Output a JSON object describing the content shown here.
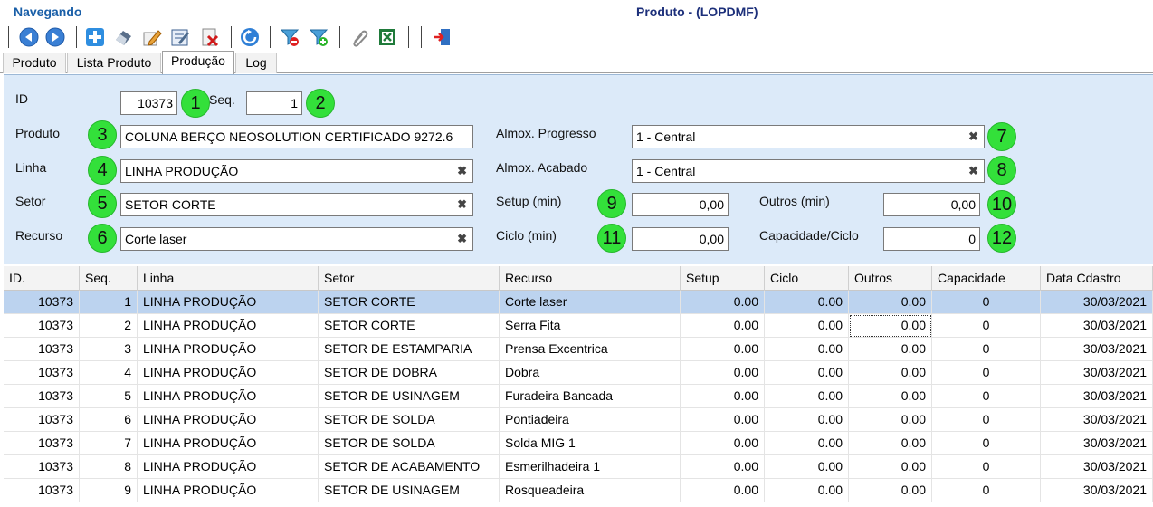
{
  "header": {
    "status": "Navegando",
    "title": "Produto - (LOPDMF)"
  },
  "toolbar": {
    "buttons": [
      "previous",
      "next",
      "new",
      "eraser",
      "edit",
      "edit-form",
      "delete",
      "refresh",
      "filter-remove",
      "filter-add",
      "attach",
      "excel",
      "exit"
    ]
  },
  "tabs": [
    "Produto",
    "Lista Produto",
    "Produção",
    "Log"
  ],
  "active_tab": "Produção",
  "form": {
    "id_label": "ID",
    "id_value": "10373",
    "seq_label": "Seq.",
    "seq_value": "1",
    "produto_label": "Produto",
    "produto_value": "COLUNA BERÇO NEOSOLUTION CERTIFICADO  9272.6",
    "linha_label": "Linha",
    "linha_value": "LINHA PRODUÇÃO",
    "setor_label": "Setor",
    "setor_value": "SETOR CORTE",
    "recurso_label": "Recurso",
    "recurso_value": "Corte laser",
    "almox_progresso_label": "Almox. Progresso",
    "almox_progresso_value": "1 - Central",
    "almox_acabado_label": "Almox. Acabado",
    "almox_acabado_value": "1 - Central",
    "setup_label": "Setup (min)",
    "setup_value": "0,00",
    "ciclo_label": "Ciclo (min)",
    "ciclo_value": "0,00",
    "outros_label": "Outros (min)",
    "outros_value": "0,00",
    "capacidade_label": "Capacidade/Ciclo",
    "capacidade_value": "0",
    "clear_glyph": "✖"
  },
  "badges": [
    "1",
    "2",
    "3",
    "4",
    "5",
    "6",
    "7",
    "8",
    "9",
    "10",
    "11",
    "12"
  ],
  "grid": {
    "columns": [
      "ID.",
      "Seq.",
      "Linha",
      "Setor",
      "Recurso",
      "Setup",
      "Ciclo",
      "Outros",
      "Capacidade",
      "Data Cdastro"
    ],
    "rows": [
      [
        "10373",
        "1",
        "LINHA PRODUÇÃO",
        "SETOR CORTE",
        "Corte laser",
        "0.00",
        "0.00",
        "0.00",
        "0",
        "30/03/2021"
      ],
      [
        "10373",
        "2",
        "LINHA PRODUÇÃO",
        "SETOR CORTE",
        "Serra Fita",
        "0.00",
        "0.00",
        "0.00",
        "0",
        "30/03/2021"
      ],
      [
        "10373",
        "3",
        "LINHA PRODUÇÃO",
        "SETOR DE ESTAMPARIA",
        "Prensa Excentrica",
        "0.00",
        "0.00",
        "0.00",
        "0",
        "30/03/2021"
      ],
      [
        "10373",
        "4",
        "LINHA PRODUÇÃO",
        "SETOR DE DOBRA",
        "Dobra",
        "0.00",
        "0.00",
        "0.00",
        "0",
        "30/03/2021"
      ],
      [
        "10373",
        "5",
        "LINHA PRODUÇÃO",
        "SETOR DE USINAGEM",
        "Furadeira Bancada",
        "0.00",
        "0.00",
        "0.00",
        "0",
        "30/03/2021"
      ],
      [
        "10373",
        "6",
        "LINHA PRODUÇÃO",
        "SETOR DE SOLDA",
        "Pontiadeira",
        "0.00",
        "0.00",
        "0.00",
        "0",
        "30/03/2021"
      ],
      [
        "10373",
        "7",
        "LINHA PRODUÇÃO",
        "SETOR DE SOLDA",
        "Solda MIG 1",
        "0.00",
        "0.00",
        "0.00",
        "0",
        "30/03/2021"
      ],
      [
        "10373",
        "8",
        "LINHA PRODUÇÃO",
        "SETOR DE ACABAMENTO",
        "Esmerilhadeira 1",
        "0.00",
        "0.00",
        "0.00",
        "0",
        "30/03/2021"
      ],
      [
        "10373",
        "9",
        "LINHA PRODUÇÃO",
        "SETOR DE USINAGEM",
        "Rosqueadeira",
        "0.00",
        "0.00",
        "0.00",
        "0",
        "30/03/2021"
      ]
    ]
  }
}
